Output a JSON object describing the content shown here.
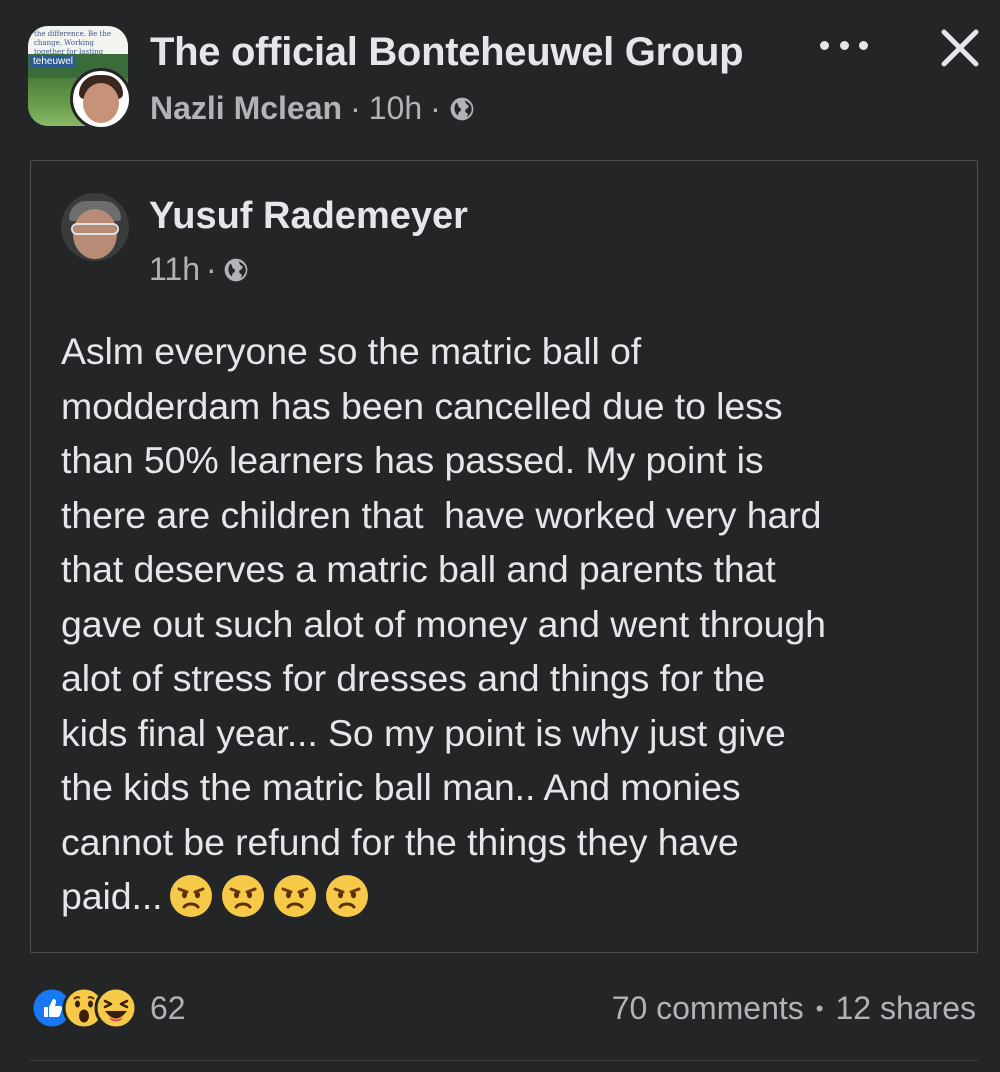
{
  "header": {
    "group_name": "The official Bonteheuwel Group",
    "group_banner_text": "the difference. Be the change. Working together for lasting change",
    "group_sub_text": "teheuwel",
    "author": "Nazli Mclean",
    "time": "10h",
    "separator": "·",
    "audience_icon": "globe-icon",
    "more_icon": "more-options-icon",
    "close_icon": "close-icon"
  },
  "shared_post": {
    "author": "Yusuf Rademeyer",
    "time": "11h",
    "separator": "·",
    "audience_icon": "globe-icon",
    "text_lines": [
      "Aslm everyone so the matric ball of",
      "modderdam has been cancelled due to less",
      "than 50% learners has passed. My point is",
      "there are children that  have worked very hard",
      "that deserves a matric ball and parents that",
      "gave out such alot of money and went through",
      "alot of stress for dresses and things for the",
      "kids final year... So my point is why just give",
      "the kids the matric ball man.. And monies",
      "cannot be refund for the things they have",
      "paid..."
    ],
    "emojis": [
      "angry-face-emoji",
      "angry-face-emoji",
      "angry-face-emoji",
      "angry-face-emoji"
    ]
  },
  "footer": {
    "reactions": [
      "like-reaction-icon",
      "wow-reaction-icon",
      "haha-reaction-icon"
    ],
    "reaction_count": "62",
    "comments": "70 comments",
    "separator": "•",
    "shares": "12 shares"
  },
  "colors": {
    "background": "#242526",
    "primary_text": "#e4e6eb",
    "secondary_text": "#b0b3b8",
    "like_blue": "#1877f2",
    "emoji_yellow": "#f7c948"
  }
}
